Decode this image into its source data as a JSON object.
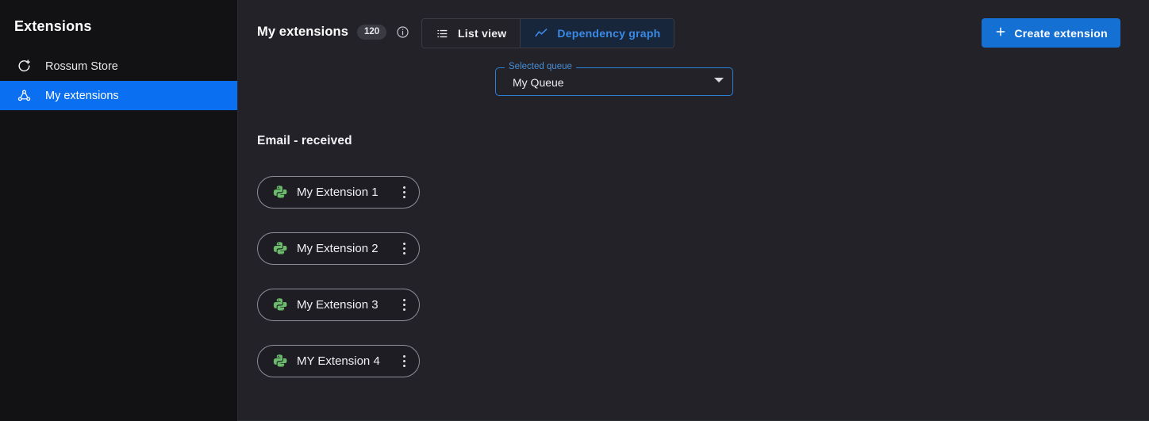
{
  "sidebar": {
    "title": "Extensions",
    "items": [
      {
        "label": "Rossum Store",
        "icon": "add-circle-icon",
        "selected": false
      },
      {
        "label": "My extensions",
        "icon": "hub-network-icon",
        "selected": true
      }
    ]
  },
  "header": {
    "page_title": "My extensions",
    "count_badge": "120",
    "info_icon": "info-circle-icon",
    "tabs": [
      {
        "label": "List view",
        "icon": "list-icon",
        "active": false
      },
      {
        "label": "Dependency graph",
        "icon": "line-chart-icon",
        "active": true
      }
    ],
    "create_button": {
      "label": "Create extension",
      "icon": "plus-icon"
    }
  },
  "queue_select": {
    "label": "Selected queue",
    "value": "My Queue",
    "icon": "chevron-down-icon"
  },
  "graph": {
    "group_title": "Email - received",
    "nodes": [
      {
        "label": "My Extension 1",
        "icon": "python-icon",
        "menu_icon": "more-vertical-icon"
      },
      {
        "label": "My Extension 2",
        "icon": "python-icon",
        "menu_icon": "more-vertical-icon"
      },
      {
        "label": "My Extension 3",
        "icon": "python-icon",
        "menu_icon": "more-vertical-icon"
      },
      {
        "label": "MY Extension 4",
        "icon": "python-icon",
        "menu_icon": "more-vertical-icon"
      }
    ]
  },
  "colors": {
    "sidebar_bg": "#121215",
    "main_bg": "#222228",
    "accent_blue": "#0a6ff0",
    "button_blue": "#1570d4",
    "tab_active_text": "#3b8ae6",
    "tab_active_bg": "#17263b",
    "select_border": "#2b7fd4",
    "python_green": "#6cbb6c",
    "chip_border": "#8e8e98",
    "chip_bg": "#1d1d23"
  }
}
